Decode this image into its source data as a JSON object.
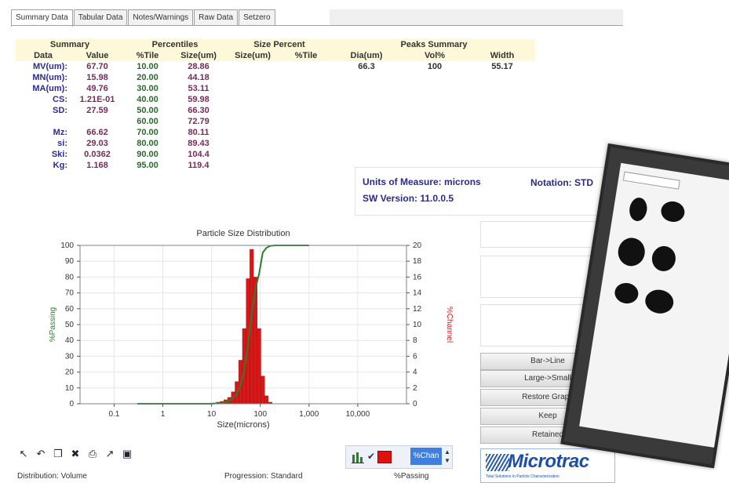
{
  "tabs": [
    "Summary Data",
    "Tabular Data",
    "Notes/Warnings",
    "Raw Data",
    "Setzero"
  ],
  "summary": {
    "header": {
      "summary": "Summary",
      "percentiles": "Percentiles",
      "size_percent": "Size Percent",
      "peaks": "Peaks Summary"
    },
    "cols": {
      "data": "Data",
      "value": "Value",
      "tile": "%Tile",
      "size": "Size(um)",
      "size2": "Size(um)",
      "tile2": "%Tile",
      "dia": "Dia(um)",
      "vol": "Vol%",
      "width": "Width"
    },
    "rows": [
      {
        "label": "MV(um):",
        "value": "67.70",
        "tile": "10.00",
        "size": "28.86"
      },
      {
        "label": "MN(um):",
        "value": "15.98",
        "tile": "20.00",
        "size": "44.18"
      },
      {
        "label": "MA(um):",
        "value": "49.76",
        "tile": "30.00",
        "size": "53.11"
      },
      {
        "label": "CS:",
        "value": "1.21E-01",
        "tile": "40.00",
        "size": "59.98"
      },
      {
        "label": "SD:",
        "value": "27.59",
        "tile": "50.00",
        "size": "66.30"
      },
      {
        "label": "",
        "value": "",
        "tile": "60.00",
        "size": "72.79"
      },
      {
        "label": "Mz:",
        "value": "66.62",
        "tile": "70.00",
        "size": "80.11"
      },
      {
        "label": "si:",
        "value": "29.03",
        "tile": "80.00",
        "size": "89.43"
      },
      {
        "label": "Ski:",
        "value": "0.0362",
        "tile": "90.00",
        "size": "104.4"
      },
      {
        "label": "Kg:",
        "value": "1.168",
        "tile": "95.00",
        "size": "119.4"
      }
    ],
    "peak": {
      "dia": "66.3",
      "vol": "100",
      "width": "55.17"
    }
  },
  "info": {
    "units_label": "Units of Measure:",
    "units_value": "microns",
    "notation_label": "Notation:",
    "notation_value": "STD",
    "sw_label": "SW Version:",
    "sw_value": "11.0.0.5"
  },
  "buttons": [
    "Bar->Line",
    "Large->Small",
    "Restore Graph",
    "Keep",
    "Retained"
  ],
  "toolbar_icons": [
    "pointer-icon",
    "undo-icon",
    "copy-icon",
    "delete-icon",
    "print-icon",
    "export-icon",
    "save-icon"
  ],
  "chart_controls": {
    "mode_label": "%Chan"
  },
  "status": {
    "distribution": "Distribution: Volume",
    "progression": "Progression: Standard",
    "passing": "%Passing"
  },
  "logo": {
    "name": "Microtrac",
    "tagline": "Total Solutions in Particle Characterization"
  },
  "colors": {
    "passing_line": "#2e7d2e",
    "channel_bars": "#d81818",
    "plot_frame": "#808080"
  },
  "chart_data": {
    "type": "bar",
    "title": "Particle Size Distribution",
    "xlabel": "Size(microns)",
    "ylabel": "%Passing",
    "y2label": "%Channel",
    "x_scale": "log",
    "xlim": [
      0.02,
      100000
    ],
    "x_ticks": [
      0.1,
      1,
      10,
      100,
      1000,
      10000
    ],
    "x_tick_labels": [
      "0.1",
      "1",
      "10",
      "100",
      "1,000",
      "10,000"
    ],
    "ylim": [
      0,
      100
    ],
    "y_ticks": [
      0,
      10,
      20,
      30,
      40,
      50,
      60,
      70,
      80,
      90,
      100
    ],
    "y2lim": [
      0,
      20
    ],
    "y2_ticks": [
      0,
      2,
      4,
      6,
      8,
      10,
      12,
      14,
      16,
      18,
      20
    ],
    "grid": true,
    "series": [
      {
        "type": "bar",
        "axis": "y2",
        "x": [
          11.5,
          13.7,
          16.4,
          19.5,
          23.3,
          27.7,
          33.0,
          39.4,
          46.9,
          55.9,
          66.5,
          79.3,
          94.4,
          112.5,
          134.1,
          159.7
        ],
        "values": [
          0.1,
          0.2,
          0.3,
          0.5,
          0.8,
          1.5,
          2.8,
          5.5,
          9.5,
          15.8,
          19.5,
          16.0,
          9.5,
          3.5,
          1.0,
          0.2
        ]
      },
      {
        "type": "line",
        "axis": "y",
        "x": [
          0.3,
          5,
          9,
          11.5,
          13.7,
          16.4,
          19.5,
          23.3,
          27.7,
          33.0,
          39.4,
          46.9,
          55.9,
          66.5,
          79.3,
          94.4,
          112.5,
          134.1,
          159.7,
          200,
          1000
        ],
        "values": [
          0,
          0,
          0,
          0.1,
          0.3,
          0.6,
          1.1,
          1.9,
          3.4,
          6.2,
          11.7,
          21.2,
          37.0,
          56.5,
          72.5,
          82.0,
          95.5,
          98.5,
          99.7,
          100,
          100
        ]
      }
    ]
  }
}
